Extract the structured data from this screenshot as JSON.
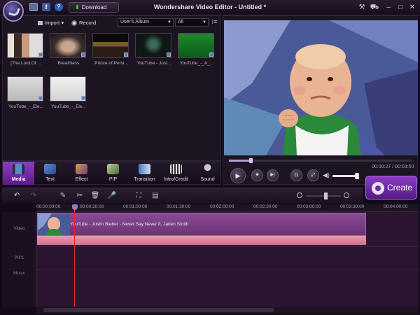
{
  "titlebar": {
    "title": "Wondershare Video Editor - Untitled *",
    "download_label": "Download",
    "facebook_glyph": "f",
    "help_glyph": "?"
  },
  "media": {
    "import_label": "Import",
    "record_label": "Record",
    "album_value": "User's Album",
    "filter_value": "All",
    "items": [
      {
        "label": "[The.Lord.Of....",
        "icon": "video-thumbnail"
      },
      {
        "label": "Breathless",
        "icon": "video-thumbnail"
      },
      {
        "label": "Prince.of.Persi...",
        "icon": "video-thumbnail"
      },
      {
        "label": "YouTube - Just...",
        "icon": "video-thumbnail"
      },
      {
        "label": "YouTube_-_A_...",
        "icon": "video-thumbnail"
      },
      {
        "label": "YouTube_-_Ele...",
        "icon": "video-thumbnail"
      },
      {
        "label": "YouTube_-_Ele...",
        "icon": "video-thumbnail"
      }
    ]
  },
  "tabs": [
    {
      "label": "Media",
      "icon": "film-icon",
      "active": true
    },
    {
      "label": "Text",
      "icon": "text-icon",
      "active": false
    },
    {
      "label": "Effect",
      "icon": "effect-icon",
      "active": false
    },
    {
      "label": "PIP",
      "icon": "pip-icon",
      "active": false
    },
    {
      "label": "Transition",
      "icon": "transition-icon",
      "active": false
    },
    {
      "label": "Intro/Credit",
      "icon": "intro-icon",
      "active": false
    },
    {
      "label": "Sound",
      "icon": "microphone-icon",
      "active": false
    }
  ],
  "preview": {
    "time": "00:00:27 / 00:03:50",
    "progress": 0.117,
    "volume": 0.95
  },
  "create_label": "Create",
  "timeline": {
    "ruler": [
      "00:00:00:00",
      "00:00:30:00",
      "00:01:00:00",
      "00:01:30:00",
      "00:02:00:00",
      "00:02:30:00",
      "00:03:00:00",
      "00:03:30:00",
      "00:04:00:00"
    ],
    "tracks": [
      "Video",
      "PIP1",
      "Music"
    ],
    "clip_title": "YouTube - Justin Bieber - Never Say Never ft. Jaden Smith",
    "zoom_level": 0.55
  },
  "colors": {
    "accent": "#8c3cc8",
    "playhead": "#e8242c",
    "clip": "#7a3e86",
    "audio": "#e08aa6"
  }
}
